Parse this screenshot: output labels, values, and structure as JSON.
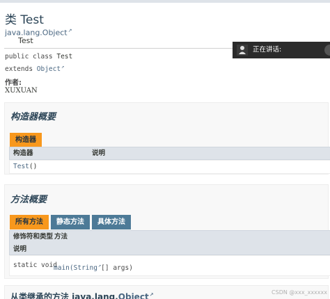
{
  "page": {
    "title": "类 Test",
    "inheritance": {
      "parent": "java.lang.Object",
      "child": "Test"
    },
    "signature": {
      "line1_prefix": "public class ",
      "line1_name": "Test",
      "line2_prefix": "extends ",
      "line2_link": "Object"
    },
    "author_label": "作者:",
    "author": "XUXUAN"
  },
  "constructor_summary": {
    "heading": "构造器概要",
    "tab": "构造器",
    "columns": [
      "构造器",
      "说明"
    ],
    "rows": [
      {
        "name": "Test",
        "suffix": "()"
      }
    ]
  },
  "method_summary": {
    "heading": "方法概要",
    "tabs": [
      "所有方法",
      "静态方法",
      "具体方法"
    ],
    "columns": [
      "修饰符和类型",
      "方法",
      "说明"
    ],
    "rows": [
      {
        "modifier": "static void",
        "method": "main",
        "param_type": "String",
        "param_suffix": "[]  args)"
      }
    ]
  },
  "inherited": {
    "prefix": "从类继承的方法 java.lang.",
    "link": "Object"
  },
  "overlay": {
    "label": "正在讲话:"
  },
  "watermark": "CSDN @xxx_xxxxxx",
  "colors": {
    "tab_active": "#f8981d",
    "tab_inactive": "#4d7a97",
    "table_header": "#dee3e9",
    "link": "#4a6782"
  }
}
